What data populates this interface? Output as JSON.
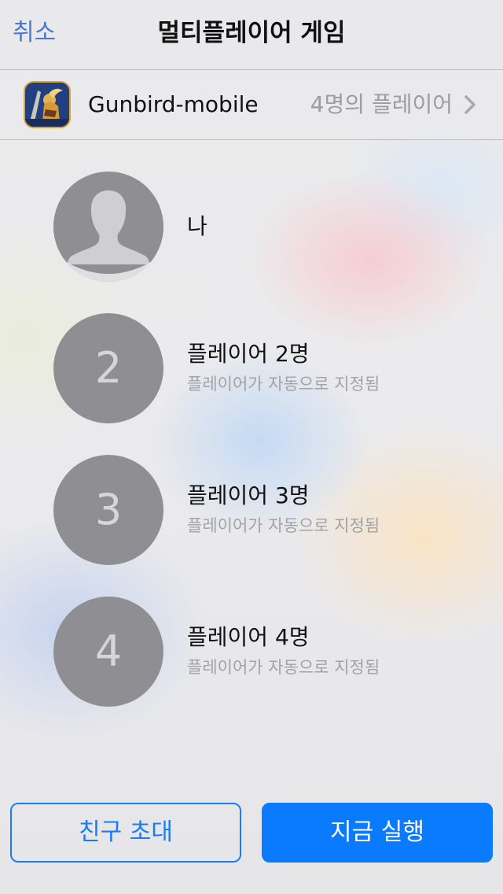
{
  "nav": {
    "cancel_label": "취소",
    "title": "멀티플레이어 게임"
  },
  "game": {
    "name": "Gunbird-mobile",
    "players_label": "4명의 플레이어",
    "icon": "gunbird-app-icon"
  },
  "players": [
    {
      "title": "나",
      "subtitle": "",
      "avatar": "person-silhouette-icon"
    },
    {
      "number": "2",
      "title": "플레이어 2명",
      "subtitle": "플레이어가 자동으로 지정됨"
    },
    {
      "number": "3",
      "title": "플레이어 3명",
      "subtitle": "플레이어가 자동으로 지정됨"
    },
    {
      "number": "4",
      "title": "플레이어 4명",
      "subtitle": "플레이어가 자동으로 지정됨"
    }
  ],
  "buttons": {
    "invite_label": "친구 초대",
    "play_label": "지금 실행"
  },
  "colors": {
    "accent": "#0a7afe",
    "avatar": "#8e8e93"
  }
}
